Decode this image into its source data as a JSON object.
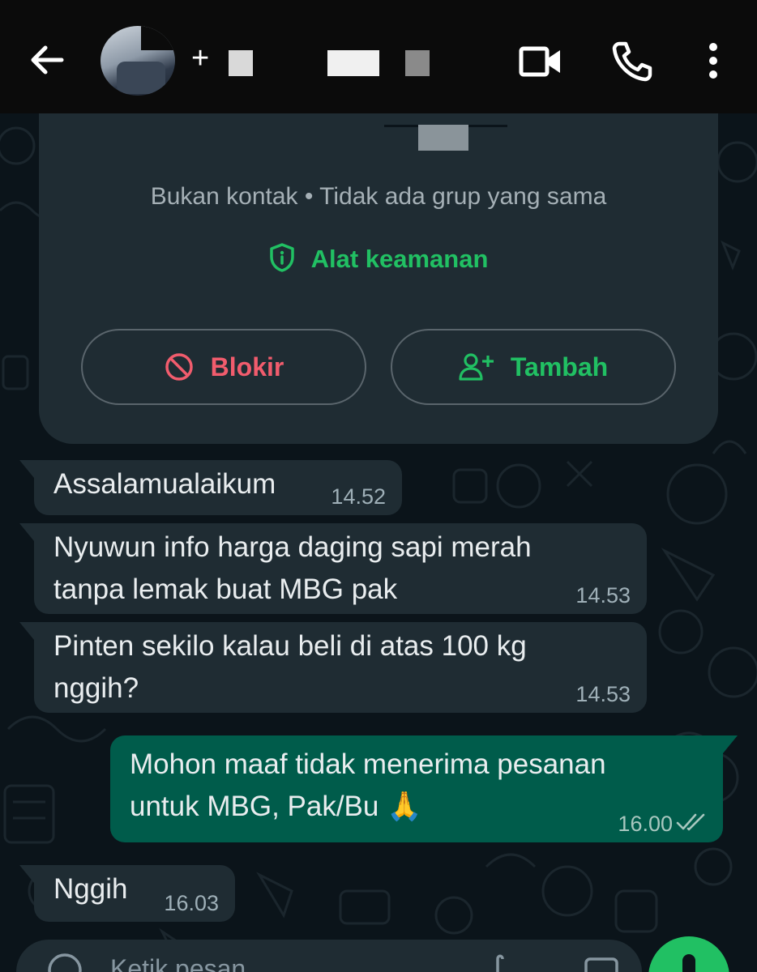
{
  "header": {
    "contact_name": "+",
    "icons": [
      "back-arrow-icon",
      "video-call-icon",
      "phone-icon",
      "more-vert-icon"
    ]
  },
  "info_card": {
    "subtitle": "Bukan kontak • Tidak ada grup yang sama",
    "security_label": "Alat keamanan",
    "block_label": "Blokir",
    "add_label": "Tambah"
  },
  "messages": [
    {
      "direction": "in",
      "lines": [
        "Assalamualaikum"
      ],
      "time": "14.52"
    },
    {
      "direction": "in",
      "lines": [
        "Nyuwun info harga daging sapi merah",
        "tanpa lemak buat MBG pak"
      ],
      "time": "14.53"
    },
    {
      "direction": "in",
      "lines": [
        "Pinten sekilo kalau beli di atas 100 kg",
        "nggih?"
      ],
      "time": "14.53"
    },
    {
      "direction": "out",
      "lines": [
        "Mohon maaf tidak menerima pesanan",
        "untuk MBG, Pak/Bu 🙏"
      ],
      "time": "16.00",
      "status": "read"
    },
    {
      "direction": "in",
      "lines": [
        "Nggih"
      ],
      "time": "16.03"
    }
  ],
  "input": {
    "placeholder": "Ketik pesan"
  },
  "colors": {
    "header_bg": "#0b0b0b",
    "chat_bg": "#0b141a",
    "incoming_bubble": "#1f2c33",
    "outgoing_bubble": "#005c4b",
    "accent_green": "#21c063",
    "block_red": "#f15c6d"
  }
}
